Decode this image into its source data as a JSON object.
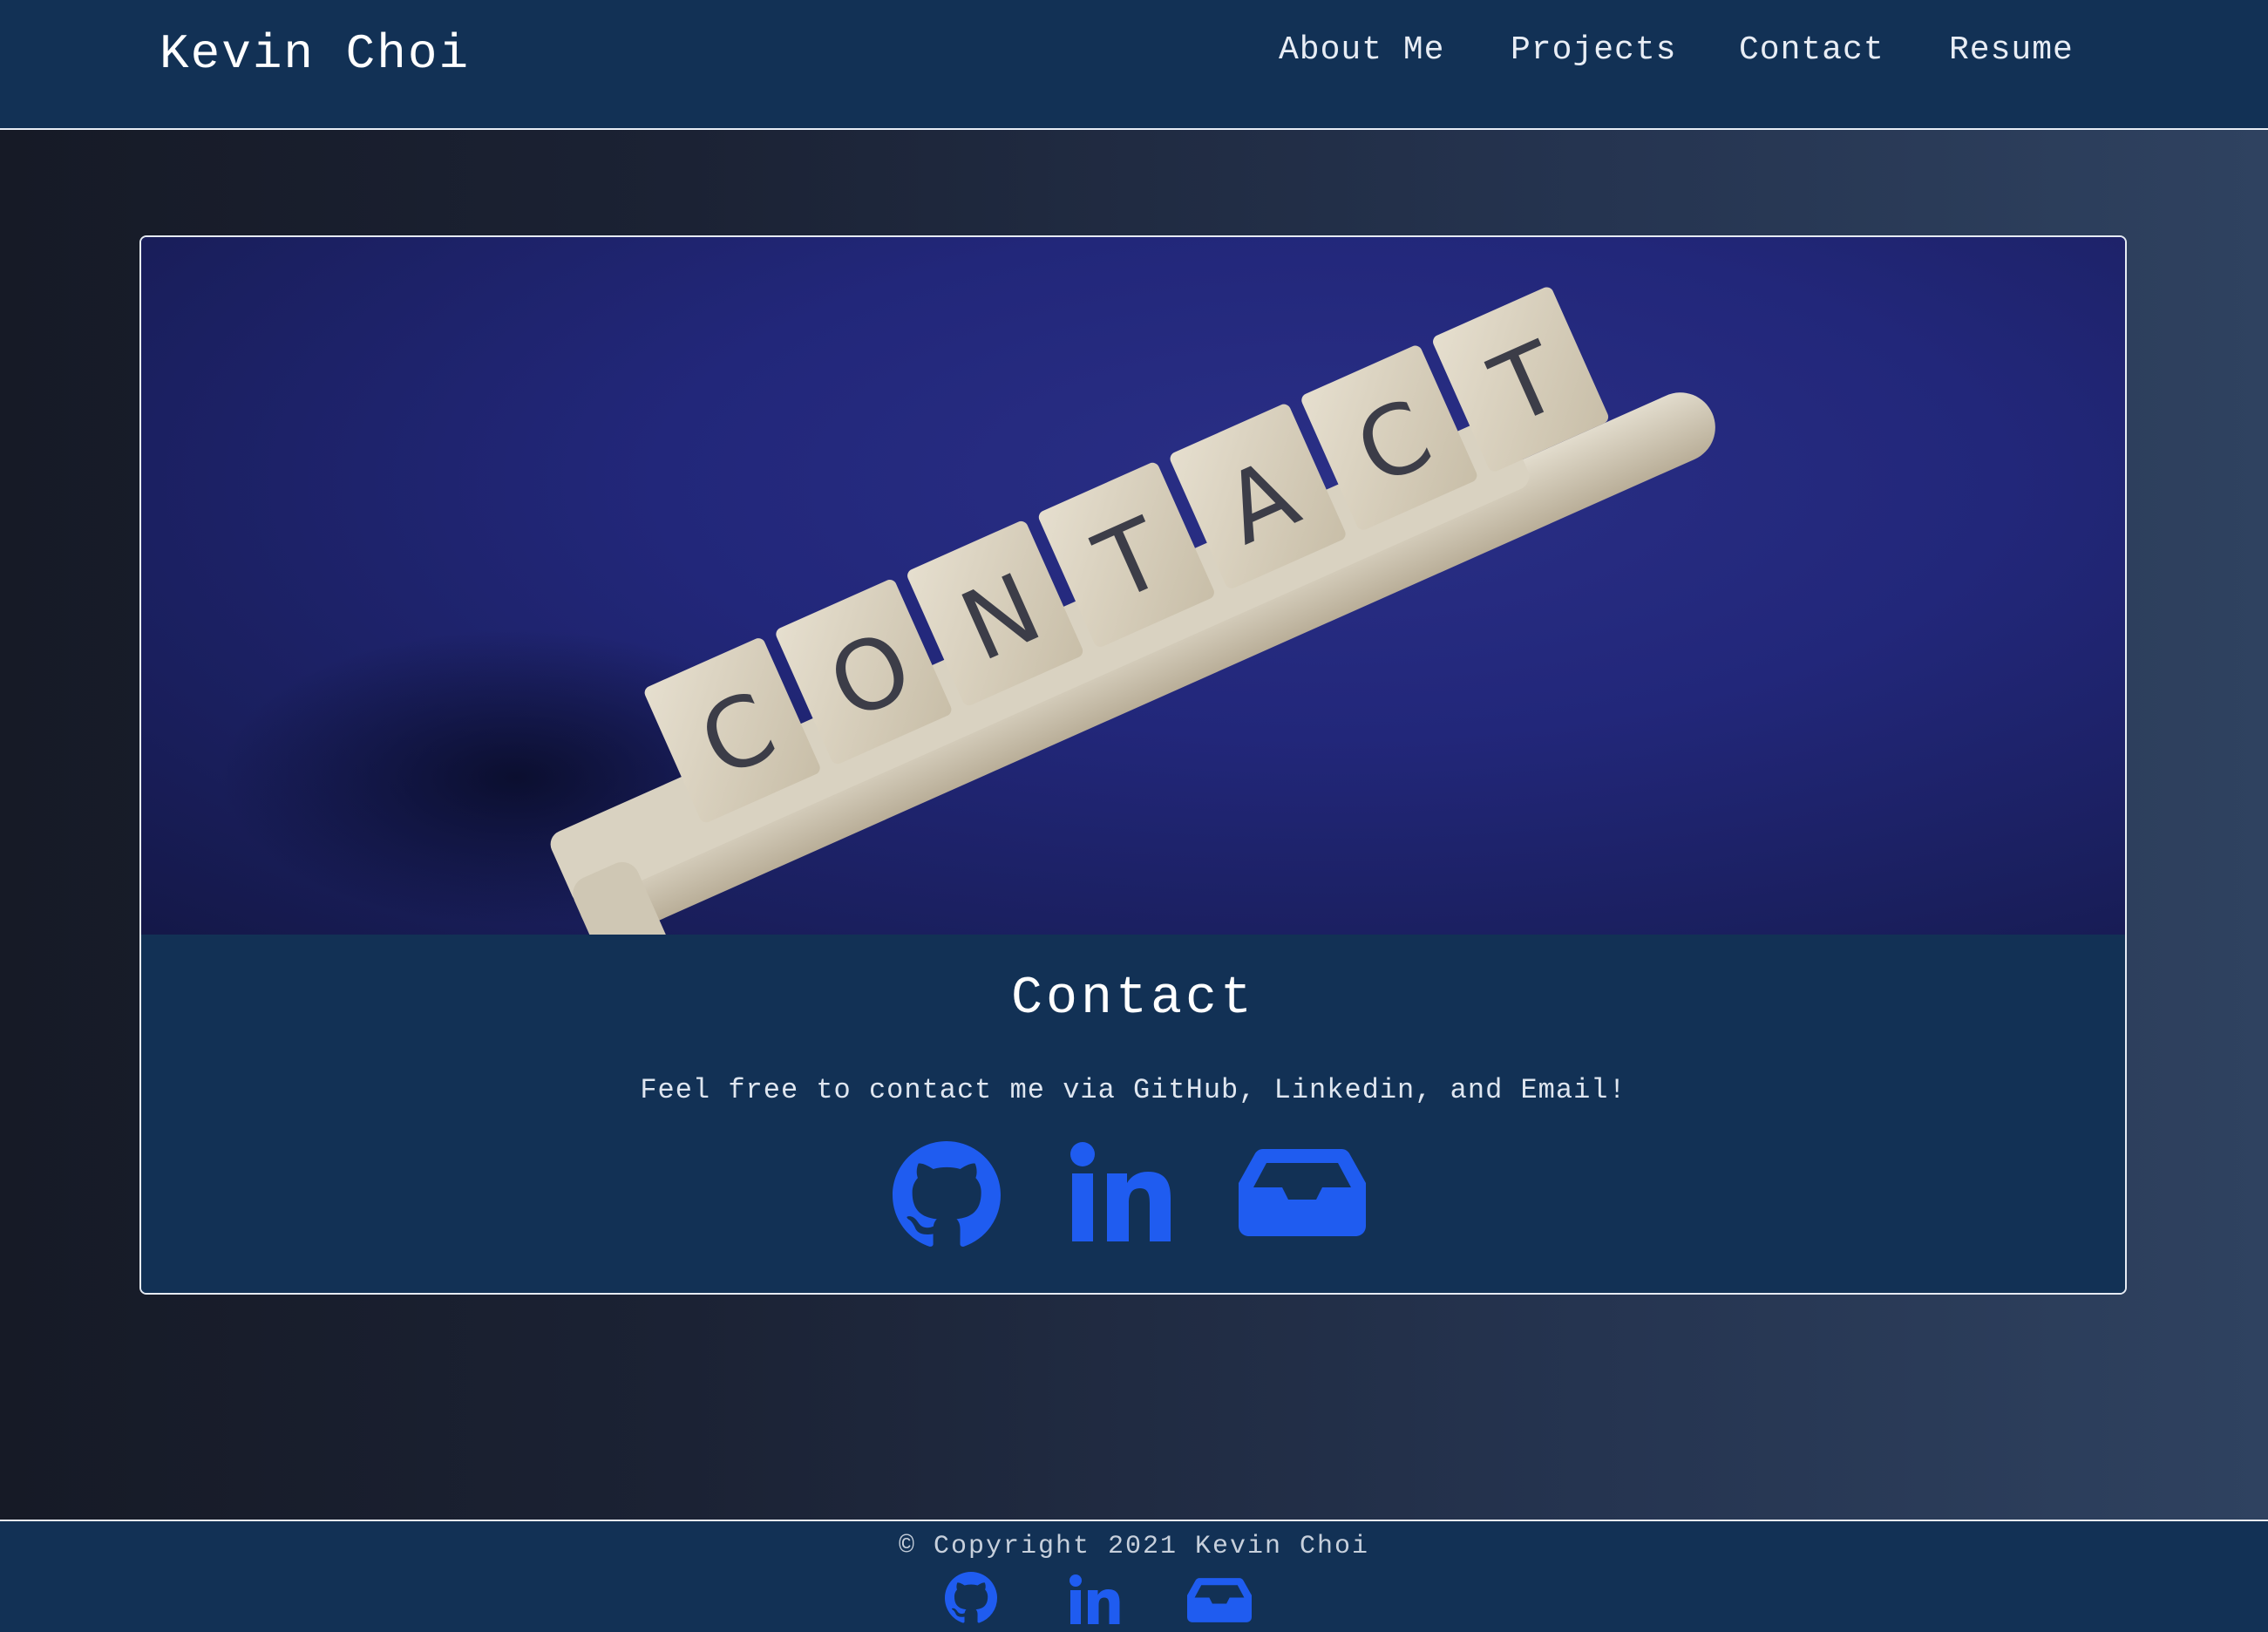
{
  "header": {
    "brand": "Kevin Choi",
    "nav": [
      {
        "label": "About Me"
      },
      {
        "label": "Projects"
      },
      {
        "label": "Contact"
      },
      {
        "label": "Resume"
      }
    ]
  },
  "card": {
    "hero_image_alt": "CONTACT",
    "title": "Contact",
    "text": "Feel free to contact me via GitHub, Linkedin, and Email!",
    "icons": [
      "github-icon",
      "linkedin-icon",
      "inbox-icon"
    ],
    "icon_color": "#1f5cf0"
  },
  "footer": {
    "copyright": "© Copyright 2021 Kevin Choi",
    "icons": [
      "github-icon",
      "linkedin-icon",
      "inbox-icon"
    ]
  },
  "colors": {
    "navbar_bg": "#123155",
    "card_bg": "#123155",
    "hero_bg": "#22277a",
    "accent_blue": "#1f5cf0"
  }
}
